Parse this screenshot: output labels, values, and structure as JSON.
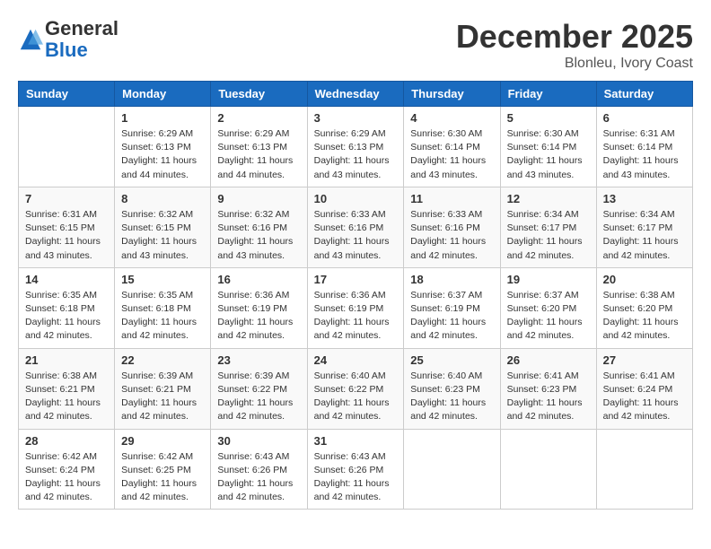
{
  "header": {
    "logo_general": "General",
    "logo_blue": "Blue",
    "month": "December 2025",
    "location": "Blonleu, Ivory Coast"
  },
  "columns": [
    "Sunday",
    "Monday",
    "Tuesday",
    "Wednesday",
    "Thursday",
    "Friday",
    "Saturday"
  ],
  "weeks": [
    [
      {
        "day": "",
        "info": ""
      },
      {
        "day": "1",
        "info": "Sunrise: 6:29 AM\nSunset: 6:13 PM\nDaylight: 11 hours\nand 44 minutes."
      },
      {
        "day": "2",
        "info": "Sunrise: 6:29 AM\nSunset: 6:13 PM\nDaylight: 11 hours\nand 44 minutes."
      },
      {
        "day": "3",
        "info": "Sunrise: 6:29 AM\nSunset: 6:13 PM\nDaylight: 11 hours\nand 43 minutes."
      },
      {
        "day": "4",
        "info": "Sunrise: 6:30 AM\nSunset: 6:14 PM\nDaylight: 11 hours\nand 43 minutes."
      },
      {
        "day": "5",
        "info": "Sunrise: 6:30 AM\nSunset: 6:14 PM\nDaylight: 11 hours\nand 43 minutes."
      },
      {
        "day": "6",
        "info": "Sunrise: 6:31 AM\nSunset: 6:14 PM\nDaylight: 11 hours\nand 43 minutes."
      }
    ],
    [
      {
        "day": "7",
        "info": "Sunrise: 6:31 AM\nSunset: 6:15 PM\nDaylight: 11 hours\nand 43 minutes."
      },
      {
        "day": "8",
        "info": "Sunrise: 6:32 AM\nSunset: 6:15 PM\nDaylight: 11 hours\nand 43 minutes."
      },
      {
        "day": "9",
        "info": "Sunrise: 6:32 AM\nSunset: 6:16 PM\nDaylight: 11 hours\nand 43 minutes."
      },
      {
        "day": "10",
        "info": "Sunrise: 6:33 AM\nSunset: 6:16 PM\nDaylight: 11 hours\nand 43 minutes."
      },
      {
        "day": "11",
        "info": "Sunrise: 6:33 AM\nSunset: 6:16 PM\nDaylight: 11 hours\nand 42 minutes."
      },
      {
        "day": "12",
        "info": "Sunrise: 6:34 AM\nSunset: 6:17 PM\nDaylight: 11 hours\nand 42 minutes."
      },
      {
        "day": "13",
        "info": "Sunrise: 6:34 AM\nSunset: 6:17 PM\nDaylight: 11 hours\nand 42 minutes."
      }
    ],
    [
      {
        "day": "14",
        "info": "Sunrise: 6:35 AM\nSunset: 6:18 PM\nDaylight: 11 hours\nand 42 minutes."
      },
      {
        "day": "15",
        "info": "Sunrise: 6:35 AM\nSunset: 6:18 PM\nDaylight: 11 hours\nand 42 minutes."
      },
      {
        "day": "16",
        "info": "Sunrise: 6:36 AM\nSunset: 6:19 PM\nDaylight: 11 hours\nand 42 minutes."
      },
      {
        "day": "17",
        "info": "Sunrise: 6:36 AM\nSunset: 6:19 PM\nDaylight: 11 hours\nand 42 minutes."
      },
      {
        "day": "18",
        "info": "Sunrise: 6:37 AM\nSunset: 6:19 PM\nDaylight: 11 hours\nand 42 minutes."
      },
      {
        "day": "19",
        "info": "Sunrise: 6:37 AM\nSunset: 6:20 PM\nDaylight: 11 hours\nand 42 minutes."
      },
      {
        "day": "20",
        "info": "Sunrise: 6:38 AM\nSunset: 6:20 PM\nDaylight: 11 hours\nand 42 minutes."
      }
    ],
    [
      {
        "day": "21",
        "info": "Sunrise: 6:38 AM\nSunset: 6:21 PM\nDaylight: 11 hours\nand 42 minutes."
      },
      {
        "day": "22",
        "info": "Sunrise: 6:39 AM\nSunset: 6:21 PM\nDaylight: 11 hours\nand 42 minutes."
      },
      {
        "day": "23",
        "info": "Sunrise: 6:39 AM\nSunset: 6:22 PM\nDaylight: 11 hours\nand 42 minutes."
      },
      {
        "day": "24",
        "info": "Sunrise: 6:40 AM\nSunset: 6:22 PM\nDaylight: 11 hours\nand 42 minutes."
      },
      {
        "day": "25",
        "info": "Sunrise: 6:40 AM\nSunset: 6:23 PM\nDaylight: 11 hours\nand 42 minutes."
      },
      {
        "day": "26",
        "info": "Sunrise: 6:41 AM\nSunset: 6:23 PM\nDaylight: 11 hours\nand 42 minutes."
      },
      {
        "day": "27",
        "info": "Sunrise: 6:41 AM\nSunset: 6:24 PM\nDaylight: 11 hours\nand 42 minutes."
      }
    ],
    [
      {
        "day": "28",
        "info": "Sunrise: 6:42 AM\nSunset: 6:24 PM\nDaylight: 11 hours\nand 42 minutes."
      },
      {
        "day": "29",
        "info": "Sunrise: 6:42 AM\nSunset: 6:25 PM\nDaylight: 11 hours\nand 42 minutes."
      },
      {
        "day": "30",
        "info": "Sunrise: 6:43 AM\nSunset: 6:26 PM\nDaylight: 11 hours\nand 42 minutes."
      },
      {
        "day": "31",
        "info": "Sunrise: 6:43 AM\nSunset: 6:26 PM\nDaylight: 11 hours\nand 42 minutes."
      },
      {
        "day": "",
        "info": ""
      },
      {
        "day": "",
        "info": ""
      },
      {
        "day": "",
        "info": ""
      }
    ]
  ]
}
